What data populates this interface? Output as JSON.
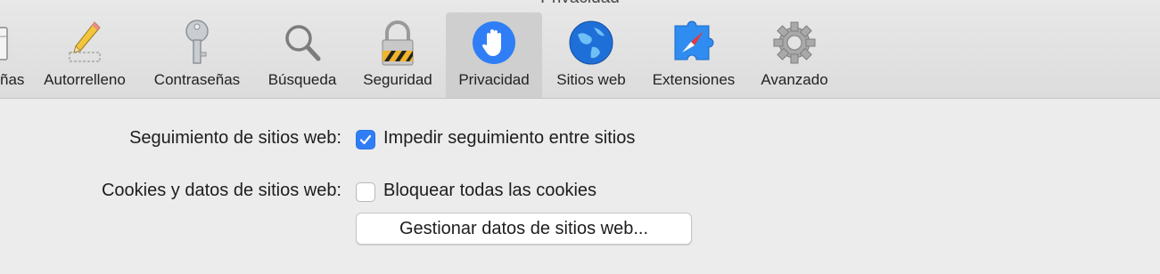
{
  "window": {
    "title": "Privacidad"
  },
  "toolbar": {
    "tabs": [
      {
        "label": "ñas",
        "icon": "general-icon",
        "selected": false
      },
      {
        "label": "Autorrelleno",
        "icon": "pencil-icon",
        "selected": false
      },
      {
        "label": "Contraseñas",
        "icon": "key-icon",
        "selected": false
      },
      {
        "label": "Búsqueda",
        "icon": "magnifier-icon",
        "selected": false
      },
      {
        "label": "Seguridad",
        "icon": "padlock-icon",
        "selected": false
      },
      {
        "label": "Privacidad",
        "icon": "hand-icon",
        "selected": true
      },
      {
        "label": "Sitios web",
        "icon": "globe-icon",
        "selected": false
      },
      {
        "label": "Extensiones",
        "icon": "puzzle-compass-icon",
        "selected": false
      },
      {
        "label": "Avanzado",
        "icon": "gear-icon",
        "selected": false
      }
    ]
  },
  "privacy": {
    "tracking": {
      "label": "Seguimiento de sitios web:",
      "checkbox_label": "Impedir seguimiento entre sitios",
      "checked": true
    },
    "cookies": {
      "label": "Cookies y datos de sitios web:",
      "checkbox_label": "Bloquear todas las cookies",
      "checked": false
    },
    "manage_button": "Gestionar datos de sitios web..."
  },
  "colors": {
    "accent": "#2f7ef6",
    "selected_tab": "#cfcfcf"
  }
}
